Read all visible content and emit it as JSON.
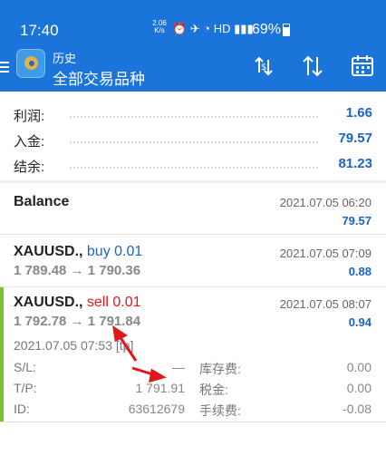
{
  "status_bar": {
    "time": "17:40",
    "speed": "2.06 K/s",
    "battery": "69%"
  },
  "header": {
    "subtitle": "历史",
    "title": "全部交易品种",
    "actions": [
      "sort-icon",
      "direction-icon",
      "calendar-icon"
    ]
  },
  "summary": {
    "rows": [
      {
        "label": "利润:",
        "value": "1.66"
      },
      {
        "label": "入金:",
        "value": "79.57"
      },
      {
        "label": "结余:",
        "value": "81.23"
      }
    ]
  },
  "deals": [
    {
      "symbol": "Balance",
      "side": "",
      "prices": "",
      "time": "2021.07.05 06:20",
      "profit": "79.57"
    },
    {
      "symbol": "XAUUSD.,",
      "side": "buy 0.01",
      "prices": "1 789.48 → 1 790.36",
      "time": "2021.07.05 07:09",
      "profit": "0.88"
    },
    {
      "symbol": "XAUUSD.,",
      "side": "sell 0.01",
      "prices": "1 792.78 → 1 791.84",
      "time": "2021.07.05 08:07",
      "profit": "0.94"
    }
  ],
  "expanded": {
    "open_time": "2021.07.05 07:53",
    "open_tag": "[tp]",
    "sl_label": "S/L:",
    "sl_value": "—",
    "tp_label": "T/P:",
    "tp_value": "1 791.91",
    "id_label": "ID:",
    "id_value": "63612679",
    "swap_label": "库存费:",
    "swap_value": "0.00",
    "tax_label": "税金:",
    "tax_value": "0.00",
    "fee_label": "手续费:",
    "fee_value": "-0.08"
  },
  "colors": {
    "primary": "#1b74d9",
    "buy": "#1a64c8",
    "sell": "#e0161b",
    "accent_bar": "#7bc12a",
    "annotation": "#e0161b"
  }
}
